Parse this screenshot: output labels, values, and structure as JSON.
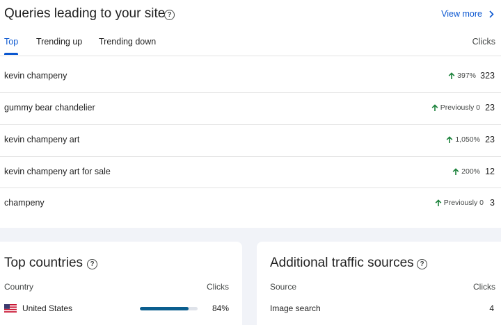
{
  "queries": {
    "title": "Queries leading to your site",
    "view_more": "View more",
    "tabs": [
      {
        "label": "Top",
        "active": true
      },
      {
        "label": "Trending up",
        "active": false
      },
      {
        "label": "Trending down",
        "active": false
      }
    ],
    "clicks_header": "Clicks",
    "rows": [
      {
        "query": "kevin champeny",
        "trend": "397%",
        "clicks": "323"
      },
      {
        "query": "gummy bear chandelier",
        "trend": "Previously 0",
        "clicks": "23"
      },
      {
        "query": "kevin champeny art",
        "trend": "1,050%",
        "clicks": "23"
      },
      {
        "query": "kevin champeny art for sale",
        "trend": "200%",
        "clicks": "12"
      },
      {
        "query": "champeny",
        "trend": "Previously 0",
        "clicks": "3"
      }
    ]
  },
  "countries": {
    "title": "Top countries",
    "col_country": "Country",
    "col_clicks": "Clicks",
    "rows": [
      {
        "country": "United States",
        "share": 0.84,
        "share_label": "84%"
      }
    ]
  },
  "traffic": {
    "title": "Additional traffic sources",
    "col_source": "Source",
    "col_clicks": "Clicks",
    "rows": [
      {
        "source": "Image search",
        "clicks": "4"
      }
    ]
  },
  "colors": {
    "accent": "#0b57d0",
    "trend_up": "#188038",
    "bar": "#0b5e8e"
  },
  "icons": [
    "help-icon",
    "chevron-right-icon",
    "arrow-up-icon",
    "us-flag-icon"
  ]
}
